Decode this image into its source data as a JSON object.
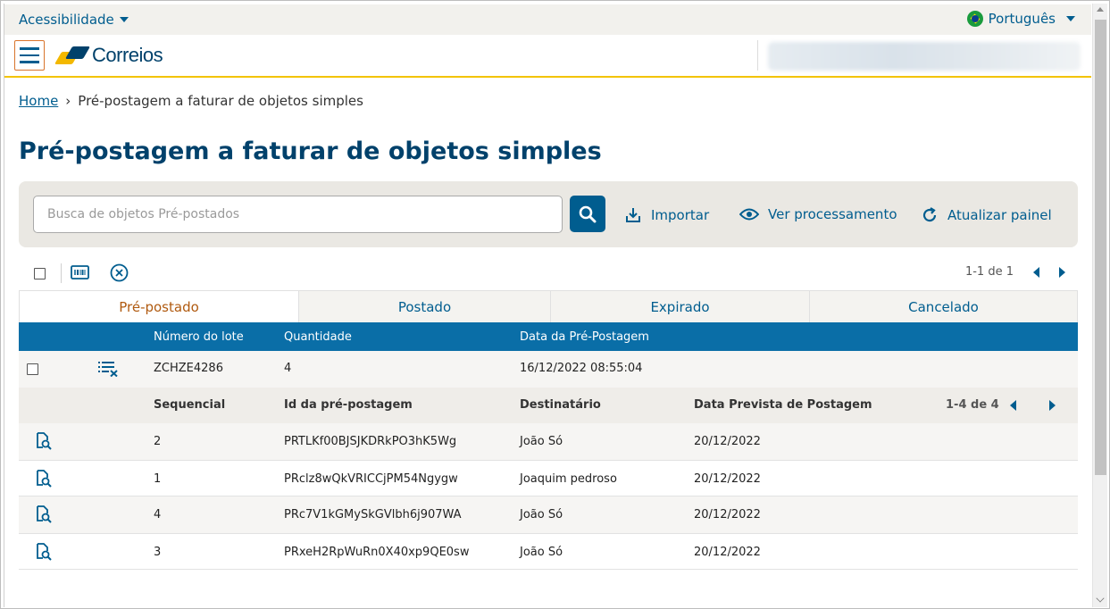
{
  "topbar": {
    "accessibility_label": "Acessibilidade",
    "language_label": "Português"
  },
  "header": {
    "brand": "Correios"
  },
  "breadcrumb": {
    "home": "Home",
    "separator": "›",
    "current": "Pré-postagem a faturar de objetos simples"
  },
  "page_title": "Pré-postagem a faturar de objetos simples",
  "search": {
    "placeholder": "Busca de objetos Pré-postados",
    "value": ""
  },
  "actions": {
    "import": "Importar",
    "view_processing": "Ver processamento",
    "refresh": "Atualizar painel"
  },
  "toolbar": {
    "pagination": "1-1 de 1"
  },
  "tabs": [
    {
      "label": "Pré-postado"
    },
    {
      "label": "Postado"
    },
    {
      "label": "Expirado"
    },
    {
      "label": "Cancelado"
    }
  ],
  "lots_table": {
    "headers": {
      "lot_number": "Número do lote",
      "quantity": "Quantidade",
      "date": "Data da Pré-Postagem"
    },
    "row": {
      "lot_number": "ZCHZE4286",
      "quantity": "4",
      "date": "16/12/2022 08:55:04"
    }
  },
  "items_table": {
    "headers": {
      "seq": "Sequencial",
      "id": "Id da pré-postagem",
      "recipient": "Destinatário",
      "date": "Data Prevista de Postagem"
    },
    "pagination": "1-4 de 4",
    "rows": [
      {
        "seq": "2",
        "id": "PRTLKf00BJSJKDRkPO3hK5Wg",
        "recipient": "João Só",
        "date": "20/12/2022"
      },
      {
        "seq": "1",
        "id": "PRclz8wQkVRICCjPM54Ngygw",
        "recipient": "Joaquim pedroso",
        "date": "20/12/2022"
      },
      {
        "seq": "4",
        "id": "PRc7V1kGMySkGVlbh6j907WA",
        "recipient": "João Só",
        "date": "20/12/2022"
      },
      {
        "seq": "3",
        "id": "PRxeH2RpWuRn0X40xp9QE0sw",
        "recipient": "João Só",
        "date": "20/12/2022"
      }
    ]
  },
  "colors": {
    "primary": "#005d8f",
    "header_blue": "#0a6ea7",
    "accent_yellow": "#f3c300",
    "active_tab": "#b05a10"
  }
}
